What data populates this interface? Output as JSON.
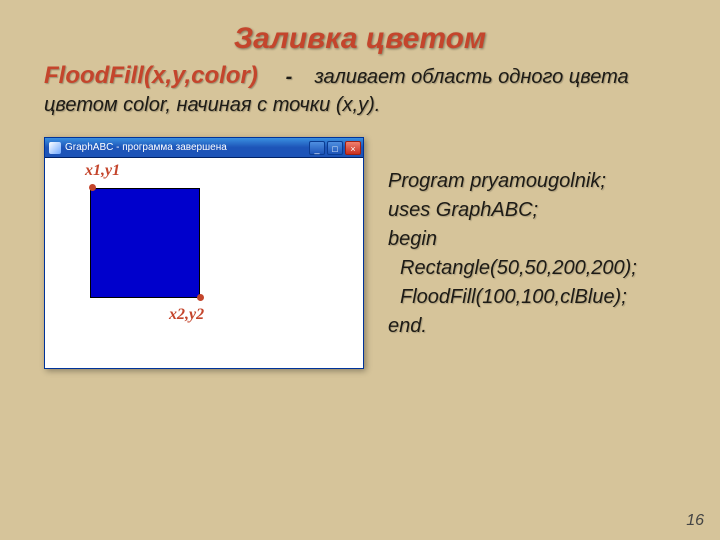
{
  "title": "Заливка цветом",
  "fn_signature": "FloodFill(x,y,color)",
  "dash": "-",
  "fn_desc_tail": "заливает область одного цвета цветом color, начиная с точки (x,y).",
  "window": {
    "title": "GraphABC - программа завершена",
    "min": "_",
    "max": "□",
    "close": "×",
    "p1_label": "x1,y1",
    "p2_label": "x2,y2"
  },
  "code": {
    "l1": "Program pryamougolnik;",
    "l2": "uses GraphABC;",
    "l3": "begin",
    "l4": "Rectangle(50,50,200,200);",
    "l5": "FloodFill(100,100,clBlue);",
    "l6": "end."
  },
  "page_number": "16"
}
